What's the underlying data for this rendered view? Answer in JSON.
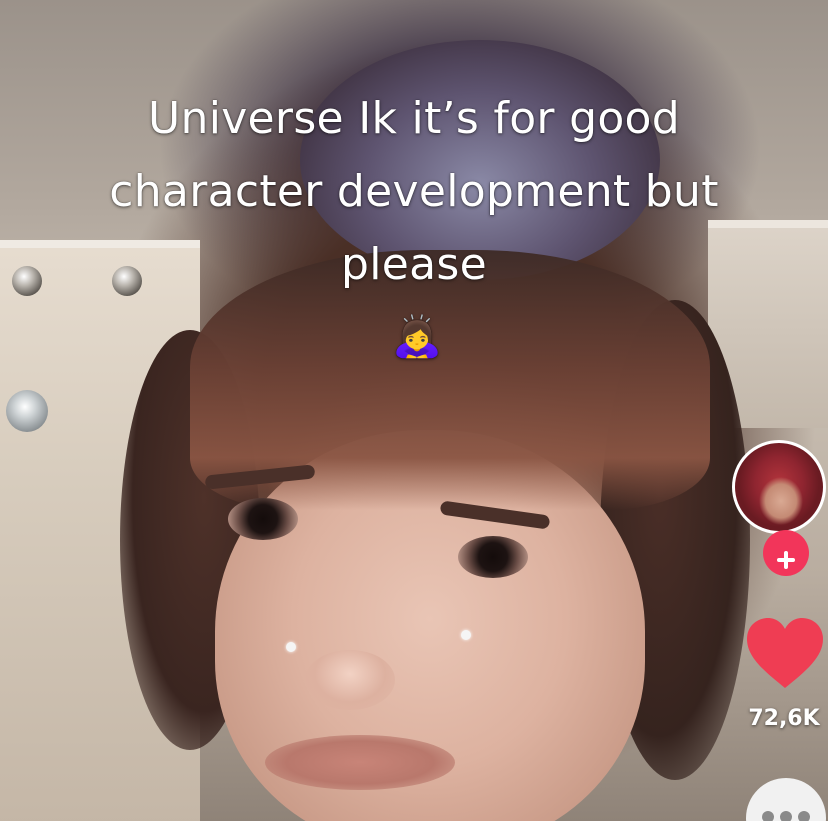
{
  "video": {
    "caption_lines": [
      "Universe Ik it’s for good",
      "character development but",
      "please"
    ],
    "caption_emoji": "🙇‍♀️",
    "caption_emoji_icon": "person-bowing-emoji-icon"
  },
  "action_rail": {
    "avatar_icon": "creator-avatar",
    "follow_icon": "plus-icon",
    "follow_color": "#f2355a",
    "like_icon": "heart-icon",
    "like_color": "#ef3d53",
    "like_count": "72,6K",
    "more_icon": "ellipsis-icon"
  }
}
